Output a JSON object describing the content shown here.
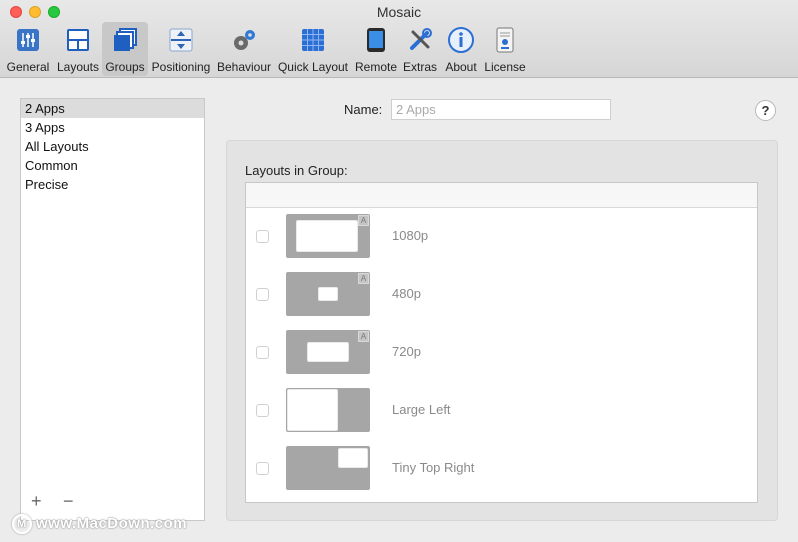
{
  "window": {
    "title": "Mosaic"
  },
  "toolbar": {
    "items": [
      {
        "label": "General",
        "icon": "sliders-icon"
      },
      {
        "label": "Layouts",
        "icon": "layouts-icon"
      },
      {
        "label": "Groups",
        "icon": "groups-icon",
        "selected": true
      },
      {
        "label": "Positioning",
        "icon": "positioning-icon"
      },
      {
        "label": "Behaviour",
        "icon": "gears-icon"
      },
      {
        "label": "Quick Layout",
        "icon": "grid-icon"
      },
      {
        "label": "Remote",
        "icon": "tablet-icon"
      },
      {
        "label": "Extras",
        "icon": "tools-icon"
      },
      {
        "label": "About",
        "icon": "info-icon"
      },
      {
        "label": "License",
        "icon": "license-icon"
      }
    ]
  },
  "sidebar": {
    "groups": [
      "2 Apps",
      "3 Apps",
      "All Layouts",
      "Common",
      "Precise"
    ],
    "selected_index": 0,
    "add_label": "+",
    "remove_label": "−"
  },
  "name": {
    "label": "Name:",
    "placeholder": "2 Apps",
    "value": ""
  },
  "help": {
    "label": "?"
  },
  "panel": {
    "title": "Layouts in Group:",
    "layouts": [
      {
        "name": "1080p",
        "checked": false,
        "badge": "A"
      },
      {
        "name": "480p",
        "checked": false,
        "badge": "A"
      },
      {
        "name": "720p",
        "checked": false,
        "badge": "A"
      },
      {
        "name": "Large Left",
        "checked": false,
        "badge": ""
      },
      {
        "name": "Tiny Top Right",
        "checked": false,
        "badge": ""
      }
    ]
  },
  "watermark": {
    "text": "www.MacDown.com",
    "logo_letter": "M"
  },
  "colors": {
    "selected_toolbar": "#c8c8c8",
    "selected_row": "#dcdcdc",
    "thumb": "#a6a6a6"
  }
}
